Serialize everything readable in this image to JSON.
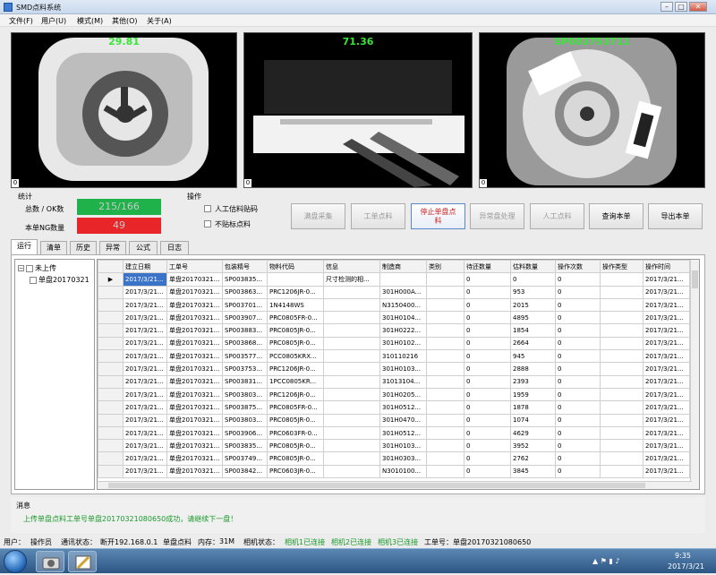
{
  "window": {
    "title": "SMD点料系统"
  },
  "menu": [
    "文件(F)",
    "用户(U)",
    "模式(M)",
    "其他(O)",
    "关于(A)"
  ],
  "cameras": [
    {
      "value": "29.81",
      "index": "0"
    },
    {
      "value": "71.36",
      "index": "0"
    },
    {
      "value": "SP003753711",
      "index": "0"
    }
  ],
  "stats": {
    "section": "统计",
    "total_label": "总数 / OK数",
    "total_value": "215/166",
    "ng_label": "本单NG数量",
    "ng_value": "49",
    "ok_color": "#1fb24a",
    "ng_color": "#e8262a"
  },
  "ops": {
    "section": "操作",
    "check1": "人工估料贴码",
    "check2": "不贴标点料",
    "buttons": [
      "满盘采集",
      "工单点料",
      "停止单盘点料",
      "异常盘处理",
      "人工点料",
      "查询本单",
      "导出本单"
    ]
  },
  "tabs": [
    "运行",
    "清单",
    "历史",
    "异常",
    "公式",
    "日志"
  ],
  "tree": {
    "root": "未上传",
    "child": "单盘20170321"
  },
  "table": {
    "headers": [
      "建立日期",
      "工单号",
      "包装精号",
      "物料代码",
      "信息",
      "制造商",
      "类别",
      "待还数量",
      "估料数量",
      "操作次数",
      "操作类型",
      "操作时间"
    ],
    "rows": [
      [
        "2017/3/21...",
        "单盘20170321...",
        "SP003835...",
        "",
        "尺寸检测的相...",
        "",
        "",
        "0",
        "0",
        "0",
        "",
        "2017/3/21..."
      ],
      [
        "2017/3/21...",
        "单盘20170321...",
        "SP003863...",
        "PRC1206JR-0...",
        "",
        "301H000A...",
        "",
        "0",
        "953",
        "0",
        "",
        "2017/3/21..."
      ],
      [
        "2017/3/21...",
        "单盘20170321...",
        "SP003701...",
        "1N4148WS",
        "",
        "N3150400...",
        "",
        "0",
        "2015",
        "0",
        "",
        "2017/3/21..."
      ],
      [
        "2017/3/21...",
        "单盘20170321...",
        "SP003907...",
        "PRC0805FR-0...",
        "",
        "301H0104...",
        "",
        "0",
        "4895",
        "0",
        "",
        "2017/3/21..."
      ],
      [
        "2017/3/21...",
        "单盘20170321...",
        "SP003883...",
        "PRC0805JR-0...",
        "",
        "301H0222...",
        "",
        "0",
        "1854",
        "0",
        "",
        "2017/3/21..."
      ],
      [
        "2017/3/21...",
        "单盘20170321...",
        "SP003868...",
        "PRC0805JR-0...",
        "",
        "301H0102...",
        "",
        "0",
        "2664",
        "0",
        "",
        "2017/3/21..."
      ],
      [
        "2017/3/21...",
        "单盘20170321...",
        "SP003577...",
        "PCC0805KRX...",
        "",
        "310110216",
        "",
        "0",
        "945",
        "0",
        "",
        "2017/3/21..."
      ],
      [
        "2017/3/21...",
        "单盘20170321...",
        "SP003753...",
        "PRC1206JR-0...",
        "",
        "301H0103...",
        "",
        "0",
        "2888",
        "0",
        "",
        "2017/3/21..."
      ],
      [
        "2017/3/21...",
        "单盘20170321...",
        "SP003831...",
        "1PCC0805KR...",
        "",
        "31013104...",
        "",
        "0",
        "2393",
        "0",
        "",
        "2017/3/21..."
      ],
      [
        "2017/3/21...",
        "单盘20170321...",
        "SP003803...",
        "PRC1206JR-0...",
        "",
        "301H0205...",
        "",
        "0",
        "1959",
        "0",
        "",
        "2017/3/21..."
      ],
      [
        "2017/3/21...",
        "单盘20170321...",
        "SP003875...",
        "PRC0805FR-0...",
        "",
        "301H0512...",
        "",
        "0",
        "1878",
        "0",
        "",
        "2017/3/21..."
      ],
      [
        "2017/3/21...",
        "单盘20170321...",
        "SP003803...",
        "PRC0805JR-0...",
        "",
        "301H0470...",
        "",
        "0",
        "1074",
        "0",
        "",
        "2017/3/21..."
      ],
      [
        "2017/3/21...",
        "单盘20170321...",
        "SP003906...",
        "PRC0603FR-0...",
        "",
        "301H0512...",
        "",
        "0",
        "4629",
        "0",
        "",
        "2017/3/21..."
      ],
      [
        "2017/3/21...",
        "单盘20170321...",
        "SP003835...",
        "PRC0805JR-0...",
        "",
        "301H0103...",
        "",
        "0",
        "3952",
        "0",
        "",
        "2017/3/21..."
      ],
      [
        "2017/3/21...",
        "单盘20170321...",
        "SP003749...",
        "PRC0805JR-0...",
        "",
        "301H0303...",
        "",
        "0",
        "2762",
        "0",
        "",
        "2017/3/21..."
      ],
      [
        "2017/3/21...",
        "单盘20170321...",
        "SP003842...",
        "PRC0603JR-0...",
        "",
        "N3010100...",
        "",
        "0",
        "3845",
        "0",
        "",
        "2017/3/21..."
      ]
    ]
  },
  "message": {
    "label": "消息",
    "text": "上传单盘点料工单号单盘20170321080650成功，请继续下一盘！"
  },
  "status": {
    "user_label": "用户：",
    "user": "操作员",
    "comm_label": "通讯状态：",
    "comm": "断开192.168.0.1",
    "mode": "单盘点料",
    "mem_label": "内存：",
    "mem": "31M",
    "cam_label": "相机状态：",
    "cam1": "相机1已连接",
    "cam2": "相机2已连接",
    "cam3": "相机3已连接",
    "order_label": "工单号：",
    "order": "单盘20170321080650"
  },
  "taskbar": {
    "time": "9:35",
    "date": "2017/3/21"
  }
}
